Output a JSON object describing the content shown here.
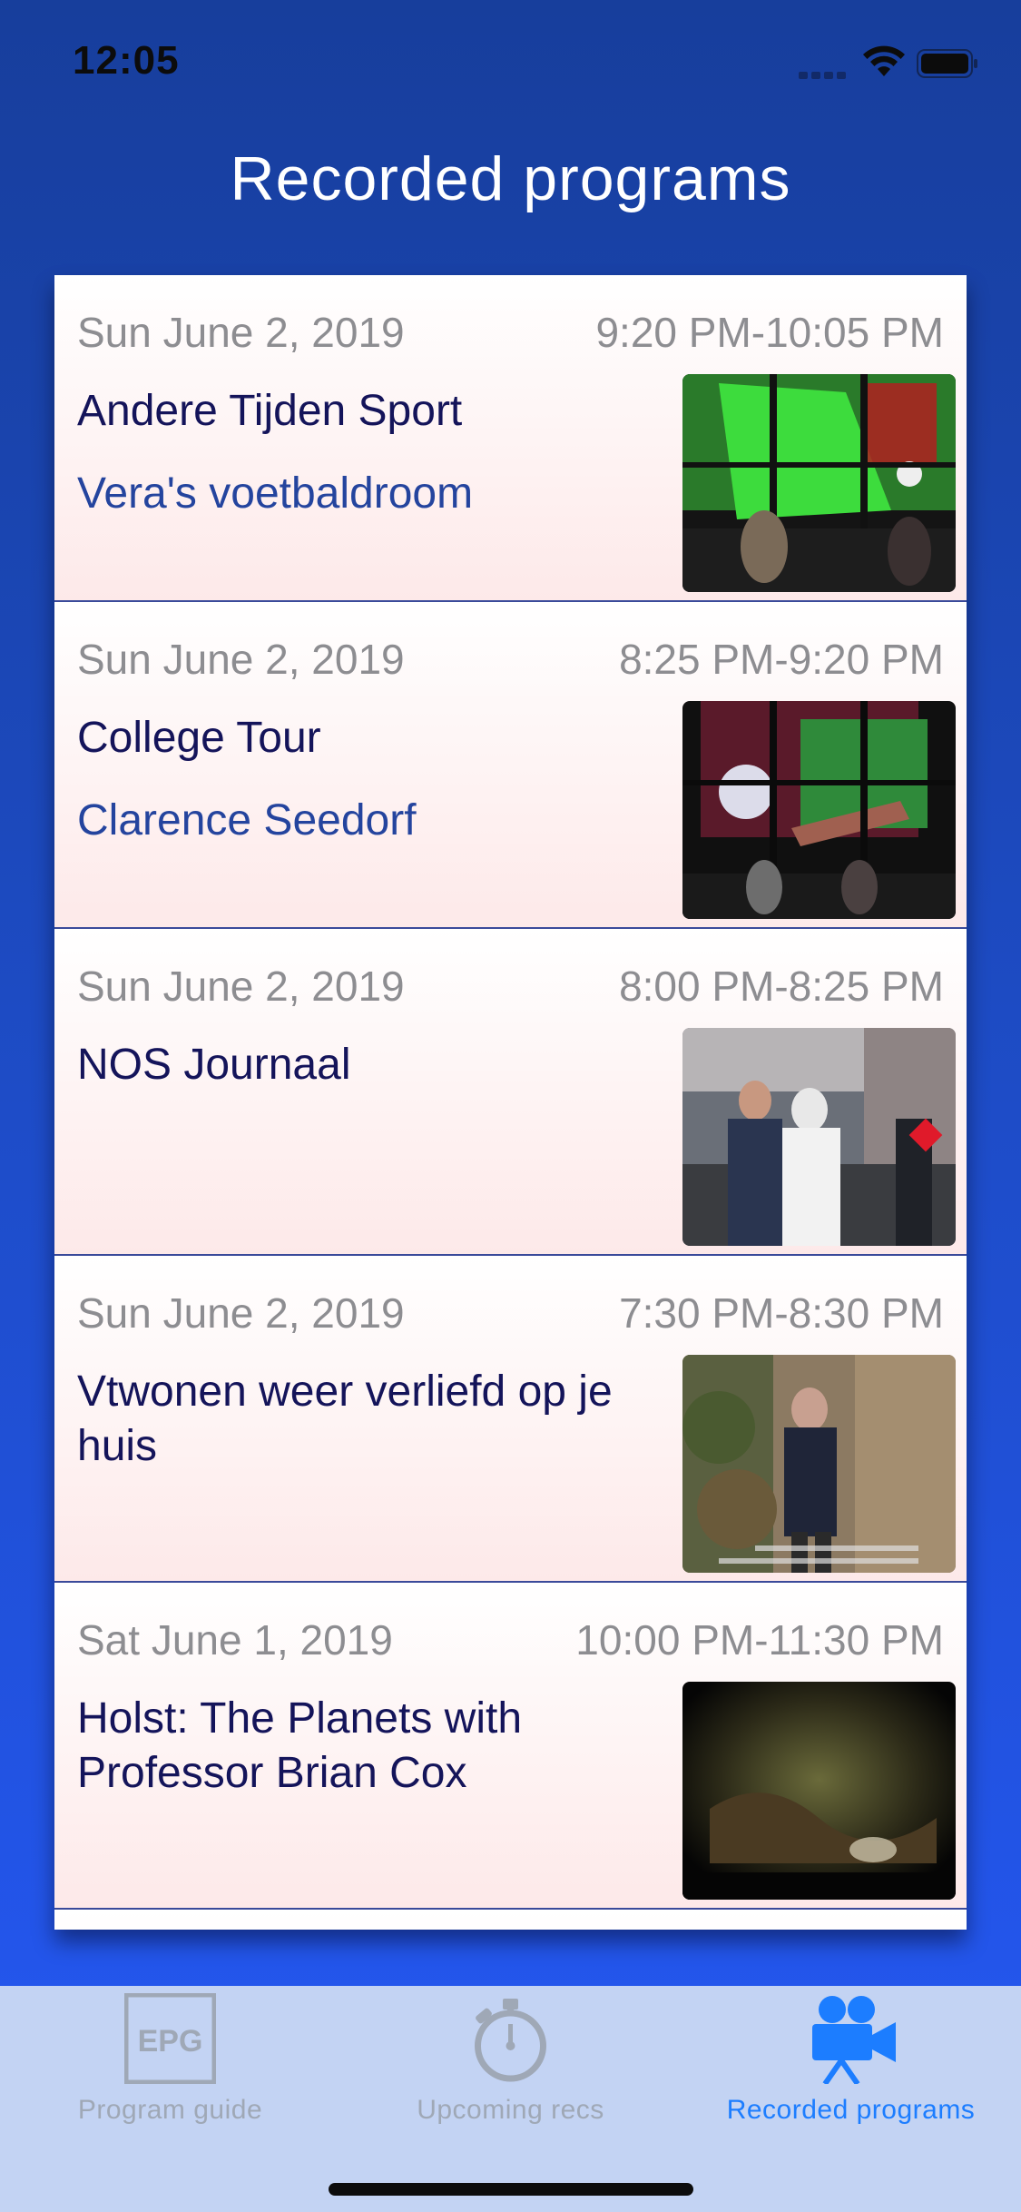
{
  "status_bar": {
    "time": "12:05"
  },
  "header": {
    "title": "Recorded programs"
  },
  "recordings": [
    {
      "date": "Sun June 2, 2019",
      "time": "9:20 PM-10:05 PM",
      "title": "Andere Tijden Sport",
      "subtitle": "Vera's voetbaldroom"
    },
    {
      "date": "Sun June 2, 2019",
      "time": "8:25 PM-9:20 PM",
      "title": "College Tour",
      "subtitle": "Clarence Seedorf"
    },
    {
      "date": "Sun June 2, 2019",
      "time": "8:00 PM-8:25 PM",
      "title": "NOS Journaal",
      "subtitle": ""
    },
    {
      "date": "Sun June 2, 2019",
      "time": "7:30 PM-8:30 PM",
      "title": "Vtwonen weer verliefd op je huis",
      "subtitle": ""
    },
    {
      "date": "Sat June 1, 2019",
      "time": "10:00 PM-11:30 PM",
      "title": "Holst: The Planets with Professor Brian Cox",
      "subtitle": ""
    }
  ],
  "tab_bar": {
    "tabs": [
      {
        "label": "Program guide",
        "icon": "epg-icon",
        "active": false
      },
      {
        "label": "Upcoming recs",
        "icon": "stopwatch-icon",
        "active": false
      },
      {
        "label": "Recorded programs",
        "icon": "video-camera-icon",
        "active": true
      }
    ]
  },
  "colors": {
    "accent": "#1c7dff",
    "title_text": "#14145a",
    "subtitle_text": "#24449e",
    "meta_text": "#8d8d91"
  }
}
